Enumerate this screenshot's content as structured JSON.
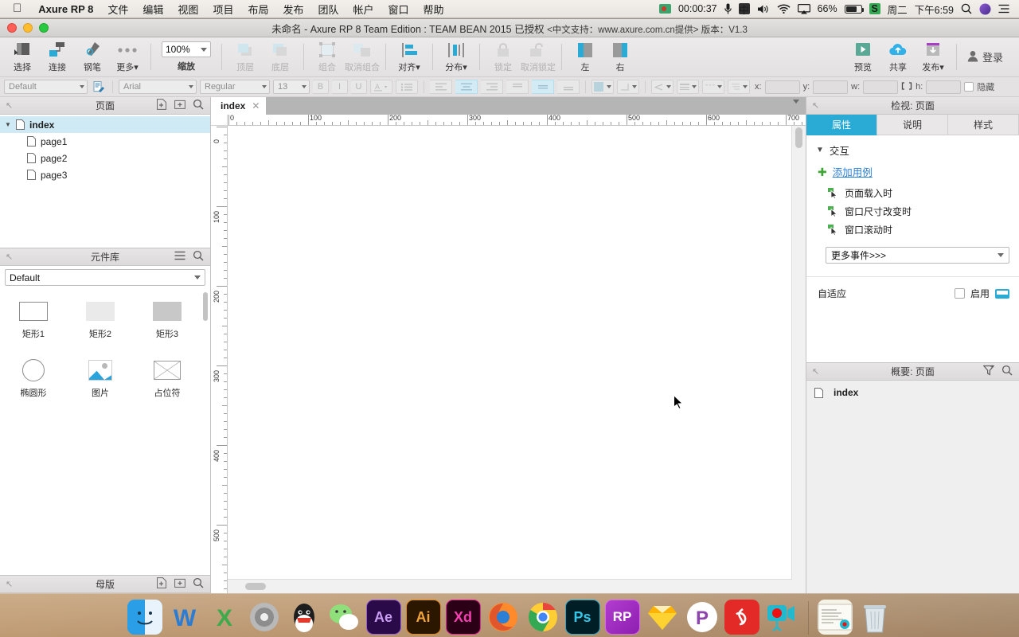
{
  "menubar": {
    "apple_icon": "apple-icon",
    "items": [
      "Axure RP 8",
      "文件",
      "编辑",
      "视图",
      "项目",
      "布局",
      "发布",
      "团队",
      "帐户",
      "窗口",
      "帮助"
    ],
    "status": {
      "recorder_icon": "screen-record-icon",
      "timer": "00:00:37",
      "mic_icon": "microphone-icon",
      "input_method": "中",
      "volume_icon": "volume-icon",
      "wifi_icon": "wifi-icon",
      "airplay_icon": "airplay-icon",
      "battery_percent": "66%",
      "battery_icon": "battery-charging-icon",
      "snipaste_icon": "s-app-icon",
      "day": "周二",
      "time": "下午6:59",
      "search_icon": "spotlight-search-icon",
      "siri_icon": "siri-icon",
      "notification_icon": "notification-center-icon"
    }
  },
  "window": {
    "title": "未命名 - Axure RP 8 Team Edition : TEAM BEAN 2015 已授权",
    "subtitle": "<中文支持：www.axure.com.cn提供> 版本：V1.3"
  },
  "toolbar": {
    "select": "选择",
    "connect": "连接",
    "pen": "钢笔",
    "more": "更多▾",
    "zoom_value": "100%",
    "zoom_label": "缩放",
    "bring_front": "顶层",
    "send_back": "底层",
    "group": "组合",
    "ungroup": "取消组合",
    "align": "对齐▾",
    "distribute": "分布▾",
    "lock": "锁定",
    "unlock": "取消锁定",
    "left": "左",
    "right": "右",
    "preview": "预览",
    "share": "共享",
    "publish": "发布▾",
    "login": "登录"
  },
  "formatbar": {
    "style": "Default",
    "font": "Arial",
    "weight": "Regular",
    "size": "13",
    "bold": "B",
    "italic": "I",
    "underline": "U",
    "x_label": "x:",
    "y_label": "y:",
    "w_label": "w:",
    "h_label": "h:",
    "x_value": "",
    "y_value": "",
    "w_value": "",
    "h_value": "",
    "hidden_label": "隐藏"
  },
  "pages_panel": {
    "title": "页面",
    "tree": [
      {
        "label": "index",
        "level": 0,
        "selected": true,
        "expanded": true
      },
      {
        "label": "page1",
        "level": 1,
        "selected": false
      },
      {
        "label": "page2",
        "level": 1,
        "selected": false
      },
      {
        "label": "page3",
        "level": 1,
        "selected": false
      }
    ]
  },
  "library_panel": {
    "title": "元件库",
    "selected_library": "Default",
    "items": [
      {
        "label": "矩形1",
        "shape": "rect-outline-icon"
      },
      {
        "label": "矩形2",
        "shape": "rect-light-icon"
      },
      {
        "label": "矩形3",
        "shape": "rect-dark-icon"
      },
      {
        "label": "椭圆形",
        "shape": "ellipse-icon"
      },
      {
        "label": "图片",
        "shape": "image-icon"
      },
      {
        "label": "占位符",
        "shape": "placeholder-icon"
      }
    ]
  },
  "masters_panel": {
    "title": "母版"
  },
  "canvas": {
    "tab_label": "index",
    "tab_close_icon": "close-icon",
    "h_ruler_ticks": [
      "0",
      "100",
      "200",
      "300",
      "400",
      "500",
      "600",
      "700"
    ],
    "v_ruler_ticks": [
      "0",
      "100",
      "200",
      "300",
      "400",
      "500"
    ],
    "cursor_icon": "mouse-pointer-icon"
  },
  "inspector": {
    "title": "检视: 页面",
    "tabs": [
      {
        "label": "属性",
        "active": true
      },
      {
        "label": "说明",
        "active": false
      },
      {
        "label": "样式",
        "active": false
      }
    ],
    "section_title": "交互",
    "add_case": "添加用例",
    "events": [
      "页面载入时",
      "窗口尺寸改变时",
      "窗口滚动时"
    ],
    "more_events": "更多事件>>>",
    "adaptive_label": "自适应",
    "adaptive_enable": "启用"
  },
  "outline": {
    "title": "概要: 页面",
    "items": [
      "index"
    ]
  },
  "dock": {
    "items": [
      {
        "name": "finder",
        "label": "",
        "color": "#2a9fe8",
        "running": true
      },
      {
        "name": "word",
        "label": "W",
        "color": "transparent",
        "running": false
      },
      {
        "name": "excel",
        "label": "X",
        "color": "transparent",
        "running": false
      },
      {
        "name": "system-preferences",
        "label": "",
        "color": "#9a9a9a",
        "running": false
      },
      {
        "name": "qq",
        "label": "",
        "color": "transparent",
        "running": false
      },
      {
        "name": "wechat",
        "label": "",
        "color": "transparent",
        "running": false
      },
      {
        "name": "after-effects",
        "label": "Ae",
        "color": "#2a0a49",
        "running": false
      },
      {
        "name": "illustrator",
        "label": "Ai",
        "color": "#2b1700",
        "running": false
      },
      {
        "name": "adobe-xd",
        "label": "Xd",
        "color": "#2b0016",
        "running": false
      },
      {
        "name": "firefox",
        "label": "",
        "color": "transparent",
        "running": false
      },
      {
        "name": "chrome",
        "label": "",
        "color": "transparent",
        "running": false
      },
      {
        "name": "photoshop",
        "label": "Ps",
        "color": "#001e26",
        "running": false
      },
      {
        "name": "axure-rp",
        "label": "RP",
        "color": "#9d28b5",
        "running": true
      },
      {
        "name": "sketch",
        "label": "",
        "color": "transparent",
        "running": false
      },
      {
        "name": "pixelmator",
        "label": "P",
        "color": "#ffffff",
        "running": false
      },
      {
        "name": "netease-music",
        "label": "",
        "color": "#e32a26",
        "running": true
      },
      {
        "name": "screen-recorder",
        "label": "",
        "color": "transparent",
        "running": true
      },
      {
        "name": "stickies",
        "label": "",
        "color": "#f5f2e8",
        "running": false
      },
      {
        "name": "trash",
        "label": "",
        "color": "transparent",
        "running": false
      }
    ]
  },
  "colors": {
    "accent": "#29abd6",
    "link": "#2b7fd4",
    "selection": "#cfeaf5",
    "green": "#3fa535"
  }
}
